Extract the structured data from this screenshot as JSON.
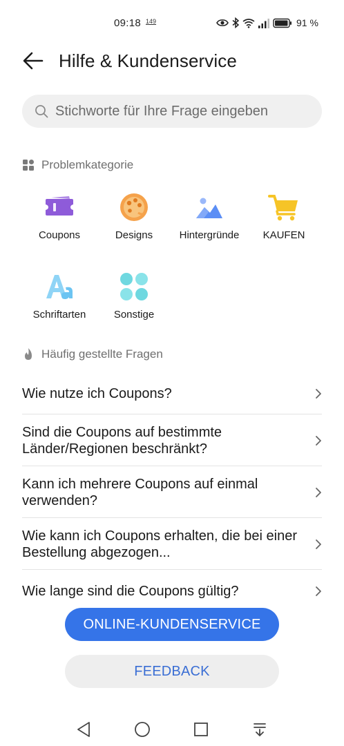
{
  "status_bar": {
    "time": "09:18",
    "subtext": "149",
    "battery_percent": "91 %",
    "icons": [
      "eye-icon",
      "bluetooth-icon",
      "wifi-icon",
      "signal-icon",
      "battery-icon"
    ]
  },
  "header": {
    "title": "Hilfe & Kundenservice"
  },
  "search": {
    "placeholder": "Stichworte für Ihre Frage eingeben"
  },
  "categories_section": {
    "title": "Problemkategorie",
    "items": [
      {
        "label": "Coupons",
        "icon": "coupon-icon",
        "color": "#8e5bd9"
      },
      {
        "label": "Designs",
        "icon": "palette-icon",
        "color": "#f5a24b"
      },
      {
        "label": "Hintergründe",
        "icon": "image-icon",
        "color": "#5b8ef5"
      },
      {
        "label": "KAUFEN",
        "icon": "cart-icon",
        "color": "#f6c427"
      },
      {
        "label": "Schriftarten",
        "icon": "font-icon",
        "color": "#6cc4f2"
      },
      {
        "label": "Sonstige",
        "icon": "grid-icon",
        "color": "#6fd8e0"
      }
    ]
  },
  "faq_section": {
    "title": "Häufig gestellte Fragen",
    "items": [
      {
        "question": "Wie nutze ich Coupons?"
      },
      {
        "question": "Sind die Coupons auf bestimmte Länder/Regionen beschränkt?"
      },
      {
        "question": "Kann ich mehrere Coupons auf einmal verwenden?"
      },
      {
        "question": "Wie kann ich Coupons erhalten, die bei einer Bestellung abgezogen..."
      },
      {
        "question": "Wie lange sind die Coupons gültig?"
      }
    ]
  },
  "buttons": {
    "online_service": "ONLINE-KUNDENSERVICE",
    "feedback": "FEEDBACK"
  },
  "colors": {
    "primary": "#3574e8",
    "secondary_bg": "#eeeeee",
    "search_bg": "#f0f0f0"
  }
}
